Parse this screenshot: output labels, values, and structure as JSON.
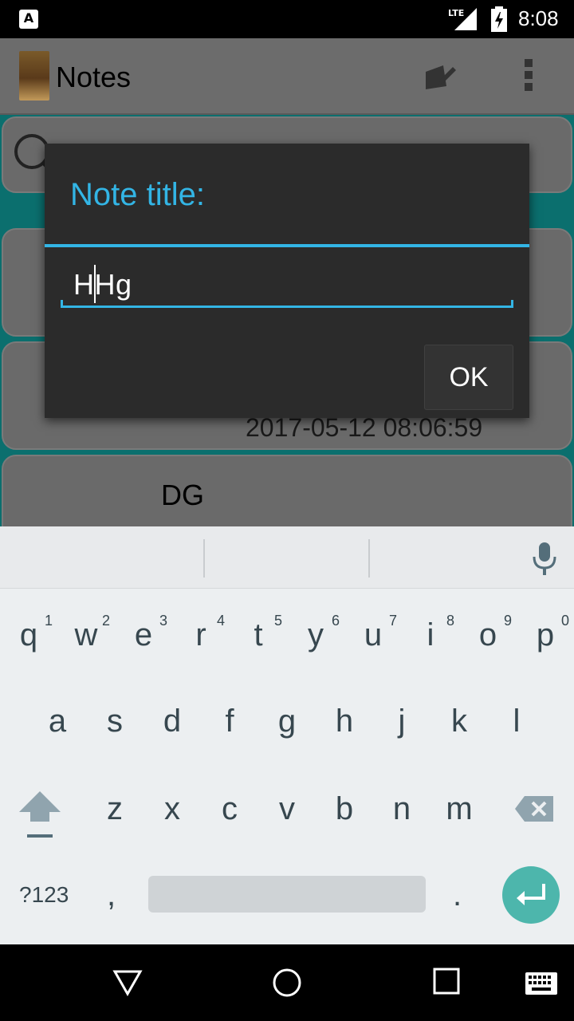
{
  "status_bar": {
    "app_badge": "A",
    "network": "LTE",
    "time": "8:08",
    "icons": [
      "notification-a-icon",
      "lte-signal-icon",
      "battery-charging-icon"
    ]
  },
  "action_bar": {
    "title": "Notes",
    "icons": [
      "app-logo-icon",
      "new-note-icon",
      "overflow-menu-icon"
    ]
  },
  "search": {
    "icon": "search-icon"
  },
  "notes": [
    {
      "title": "",
      "date": ""
    },
    {
      "title": "",
      "date": "2017-05-12 08:06:59"
    },
    {
      "title": "DG",
      "date": ""
    }
  ],
  "dialog": {
    "title": "Note title:",
    "input_value": "HHg",
    "ok_label": "OK"
  },
  "keyboard": {
    "row1": [
      {
        "label": "q",
        "hint": "1"
      },
      {
        "label": "w",
        "hint": "2"
      },
      {
        "label": "e",
        "hint": "3"
      },
      {
        "label": "r",
        "hint": "4"
      },
      {
        "label": "t",
        "hint": "5"
      },
      {
        "label": "y",
        "hint": "6"
      },
      {
        "label": "u",
        "hint": "7"
      },
      {
        "label": "i",
        "hint": "8"
      },
      {
        "label": "o",
        "hint": "9"
      },
      {
        "label": "p",
        "hint": "0"
      }
    ],
    "row2": [
      "a",
      "s",
      "d",
      "f",
      "g",
      "h",
      "j",
      "k",
      "l"
    ],
    "row3": [
      "z",
      "x",
      "c",
      "v",
      "b",
      "n",
      "m"
    ],
    "symbols_label": "?123",
    "comma_label": ",",
    "period_label": ".",
    "accent_color": "#4db6ac"
  },
  "nav_bar": {
    "icons": [
      "back-icon",
      "home-icon",
      "recents-icon",
      "keyboard-switch-icon"
    ]
  }
}
